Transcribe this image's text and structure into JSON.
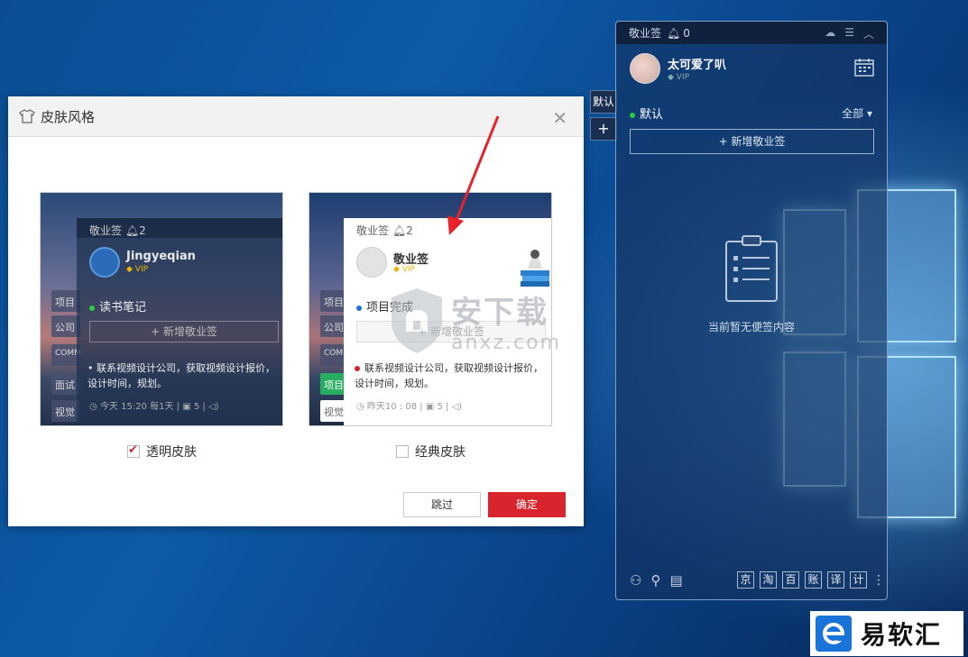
{
  "dialog": {
    "title": "皮肤风格",
    "close": "✕",
    "skip": "跳过",
    "confirm": "确定",
    "options": [
      {
        "label": "透明皮肤",
        "checked": true
      },
      {
        "label": "经典皮肤",
        "checked": false
      }
    ]
  },
  "preview_transparent": {
    "app": "敬业签",
    "bell_count": "2",
    "name": "Jingyeqian",
    "vip": "VIP",
    "tabs": [
      "项目",
      "公司",
      "COMM",
      "面试",
      "视觉"
    ],
    "folder": "读书笔记",
    "new_btn": "+ 新增敬业签",
    "note": "• 联系视频设计公司，获取视频设计报价，设计时间，规划。",
    "meta_time": "今天 15:20",
    "meta_repeat": "每1天",
    "meta_count": "5"
  },
  "preview_classic": {
    "app": "敬业签",
    "bell_count": "2",
    "name": "敬业签",
    "vip": "VIP",
    "tabs": [
      "项目",
      "公司",
      "COMM",
      "项目",
      "视觉"
    ],
    "folder": "项目完成",
    "new_btn": "+ 新增敬业签",
    "note": "联系视频设计公司，获取视频设计报价，设计时间，规划。",
    "meta_time": "昨天10 : 08",
    "meta_count": "5"
  },
  "side_tabs": [
    "默认",
    "+"
  ],
  "widget": {
    "app": "敬业签",
    "bell_count": "0",
    "username": "太可爱了叭",
    "vip": "VIP",
    "folder": "默认",
    "filter": "全部",
    "new_btn": "+ 新增敬业签",
    "empty": "当前暂无便签内容",
    "toolbar_boxes": [
      "京",
      "淘",
      "百",
      "账",
      "译",
      "计"
    ]
  },
  "watermark": {
    "cn": "安下载",
    "en": "anxz.com"
  },
  "brand": {
    "text": "易软汇"
  },
  "colors": {
    "accent_red": "#d9232d",
    "widget_bg": "#14325f",
    "online_green": "#2ecc40"
  }
}
